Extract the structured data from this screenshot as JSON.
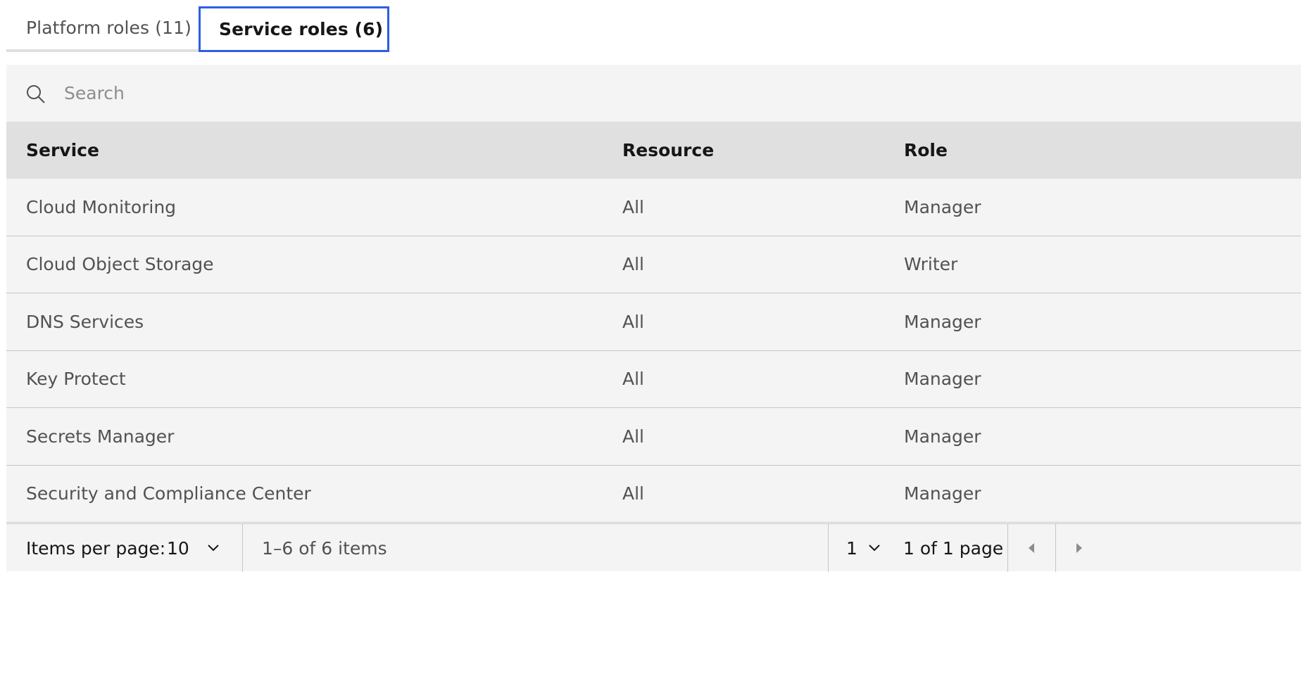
{
  "tabs": [
    {
      "label": "Platform roles (11)",
      "selected": false
    },
    {
      "label": "Service roles (6)",
      "selected": true
    }
  ],
  "search": {
    "placeholder": "Search",
    "icon": "search-icon"
  },
  "table": {
    "headers": [
      "Service",
      "Resource",
      "Role"
    ],
    "rows": [
      [
        "Cloud Monitoring",
        "All",
        "Manager"
      ],
      [
        "Cloud Object Storage",
        "All",
        "Writer"
      ],
      [
        "DNS Services",
        "All",
        "Manager"
      ],
      [
        "Key Protect",
        "All",
        "Manager"
      ],
      [
        "Secrets Manager",
        "All",
        "Manager"
      ],
      [
        "Security and Compliance Center",
        "All",
        "Manager"
      ]
    ]
  },
  "pagination": {
    "items_per_page_label": "Items per page:",
    "items_per_page_value": "10",
    "range_text": "1–6 of 6 items",
    "page_value": "1",
    "page_of_text": "1 of 1 page"
  },
  "colors": {
    "accent": "#2f5fe1",
    "surface": "#f4f4f4",
    "header": "#e0e0e0"
  }
}
